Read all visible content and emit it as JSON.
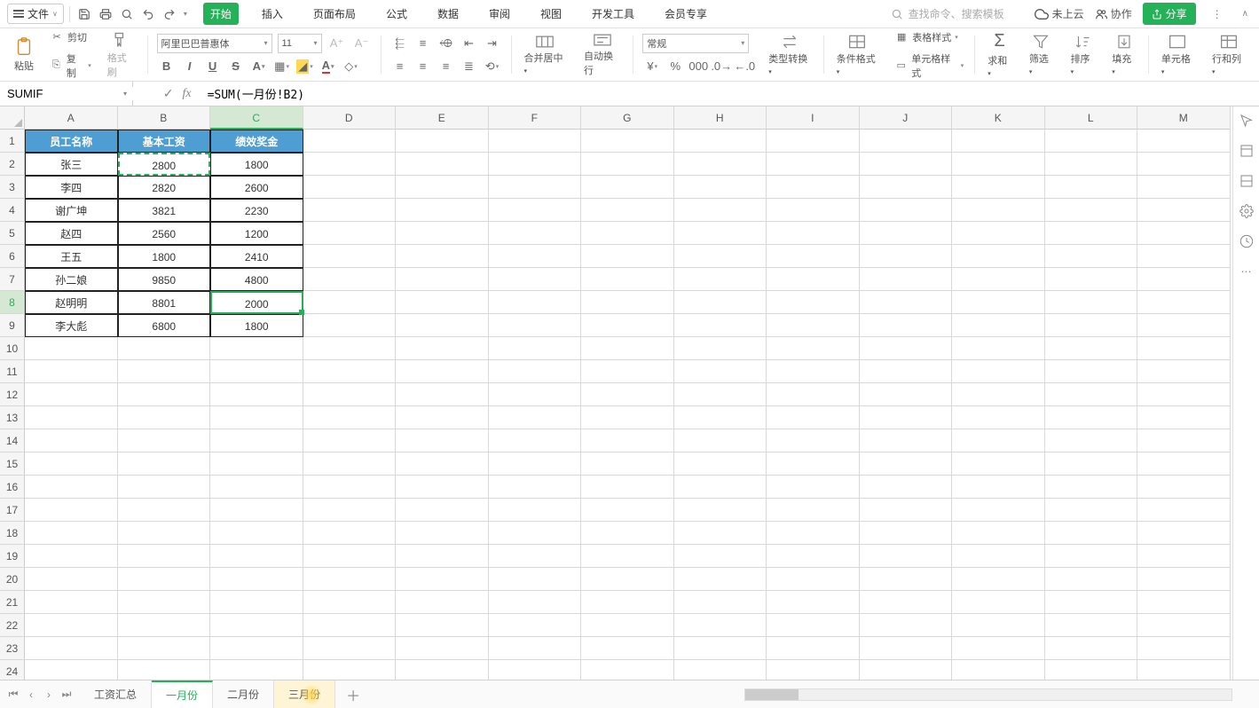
{
  "topbar": {
    "file_label": "文件",
    "menu": [
      "开始",
      "插入",
      "页面布局",
      "公式",
      "数据",
      "审阅",
      "视图",
      "开发工具",
      "会员专享"
    ],
    "search_placeholder": "查找命令、搜索模板",
    "cloud_status": "未上云",
    "cooperate": "协作",
    "share": "分享"
  },
  "ribbon": {
    "paste": "粘贴",
    "cut": "剪切",
    "copy": "复制",
    "format_painter": "格式刷",
    "font_name": "阿里巴巴普惠体",
    "font_size": "11",
    "merge": "合并居中",
    "wrap": "自动换行",
    "number_format": "常规",
    "type_convert": "类型转换",
    "cond_fmt": "条件格式",
    "table_style": "表格样式",
    "cell_style": "单元格样式",
    "sum": "求和",
    "filter": "筛选",
    "sort": "排序",
    "fill": "填充",
    "cells": "单元格",
    "rows_cols": "行和列"
  },
  "formula_bar": {
    "namebox": "SUMIF",
    "formula": "=SUM(一月份!B2)"
  },
  "columns": [
    "A",
    "B",
    "C",
    "D",
    "E",
    "F",
    "G",
    "H",
    "I",
    "J",
    "K",
    "L",
    "M"
  ],
  "row_count": 24,
  "headers": {
    "A": "员工名称",
    "B": "基本工资",
    "C": "绩效奖金"
  },
  "rows": [
    {
      "A": "张三",
      "B": "2800",
      "C": "1800"
    },
    {
      "A": "李四",
      "B": "2820",
      "C": "2600"
    },
    {
      "A": "谢广坤",
      "B": "3821",
      "C": "2230"
    },
    {
      "A": "赵四",
      "B": "2560",
      "C": "1200"
    },
    {
      "A": "王五",
      "B": "1800",
      "C": "2410"
    },
    {
      "A": "孙二娘",
      "B": "9850",
      "C": "4800"
    },
    {
      "A": "赵明明",
      "B": "8801",
      "C": "2000"
    },
    {
      "A": "李大彪",
      "B": "6800",
      "C": "1800"
    }
  ],
  "active_cell": "C8",
  "marching_cell": "B2",
  "sheet_tabs": [
    "工资汇总",
    "一月份",
    "二月份",
    "三月份"
  ],
  "active_tab": 1,
  "hover_tab": 3,
  "chart_data": null
}
